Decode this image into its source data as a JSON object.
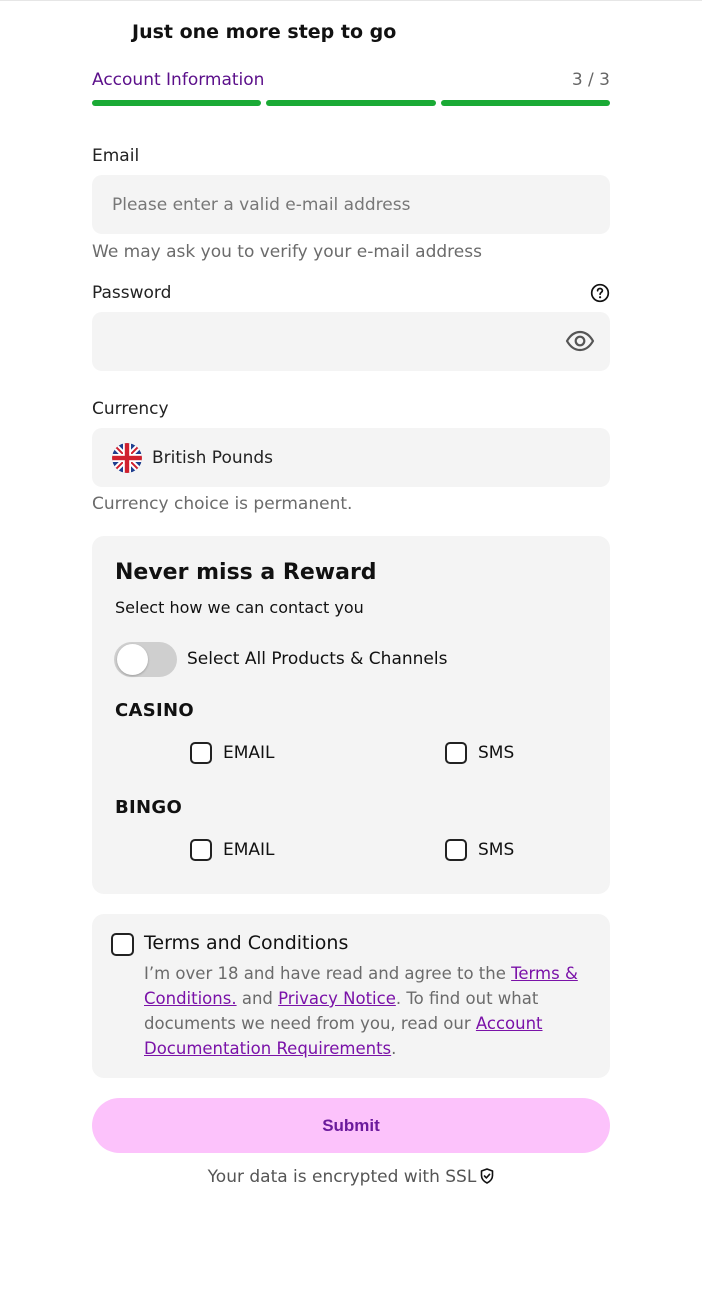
{
  "header": {
    "title": "Just one more step to go",
    "step_label": "Account Information",
    "step_count": "3 / 3",
    "progress_steps_done": 3,
    "progress_steps_total": 3
  },
  "email": {
    "label": "Email",
    "placeholder": "Please enter a valid e-mail address",
    "value": "",
    "hint": "We may ask you to verify your e-mail address"
  },
  "password": {
    "label": "Password",
    "value": "",
    "help_icon": "question-circle-icon",
    "toggle_icon": "eye-icon"
  },
  "currency": {
    "label": "Currency",
    "selected": "British Pounds",
    "flag_icon": "uk-flag-icon",
    "hint": "Currency choice is permanent."
  },
  "rewards": {
    "title": "Never miss a Reward",
    "subtitle": "Select how we can contact you",
    "toggle_label": "Select All Products & Channels",
    "toggle_on": false,
    "categories": [
      {
        "name": "CASINO",
        "options": [
          "EMAIL",
          "SMS"
        ]
      },
      {
        "name": "BINGO",
        "options": [
          "EMAIL",
          "SMS"
        ]
      }
    ]
  },
  "terms": {
    "title": "Terms and Conditions",
    "text_1": "I’m over 18 and have read and agree to the ",
    "link_terms": "Terms & Conditions.",
    "text_2": " and ",
    "link_privacy": "Privacy Notice",
    "text_3": ". To find out what documents we need from you, read our ",
    "link_docs": "Account Documentation Requirements",
    "text_4": "."
  },
  "submit_label": "Submit",
  "ssl_text": "Your data is encrypted with SSL",
  "colors": {
    "accent_purple": "#5b0f8a",
    "progress_green": "#1aaa35",
    "submit_bg": "#fcc2fb",
    "field_bg": "#f4f4f4"
  }
}
